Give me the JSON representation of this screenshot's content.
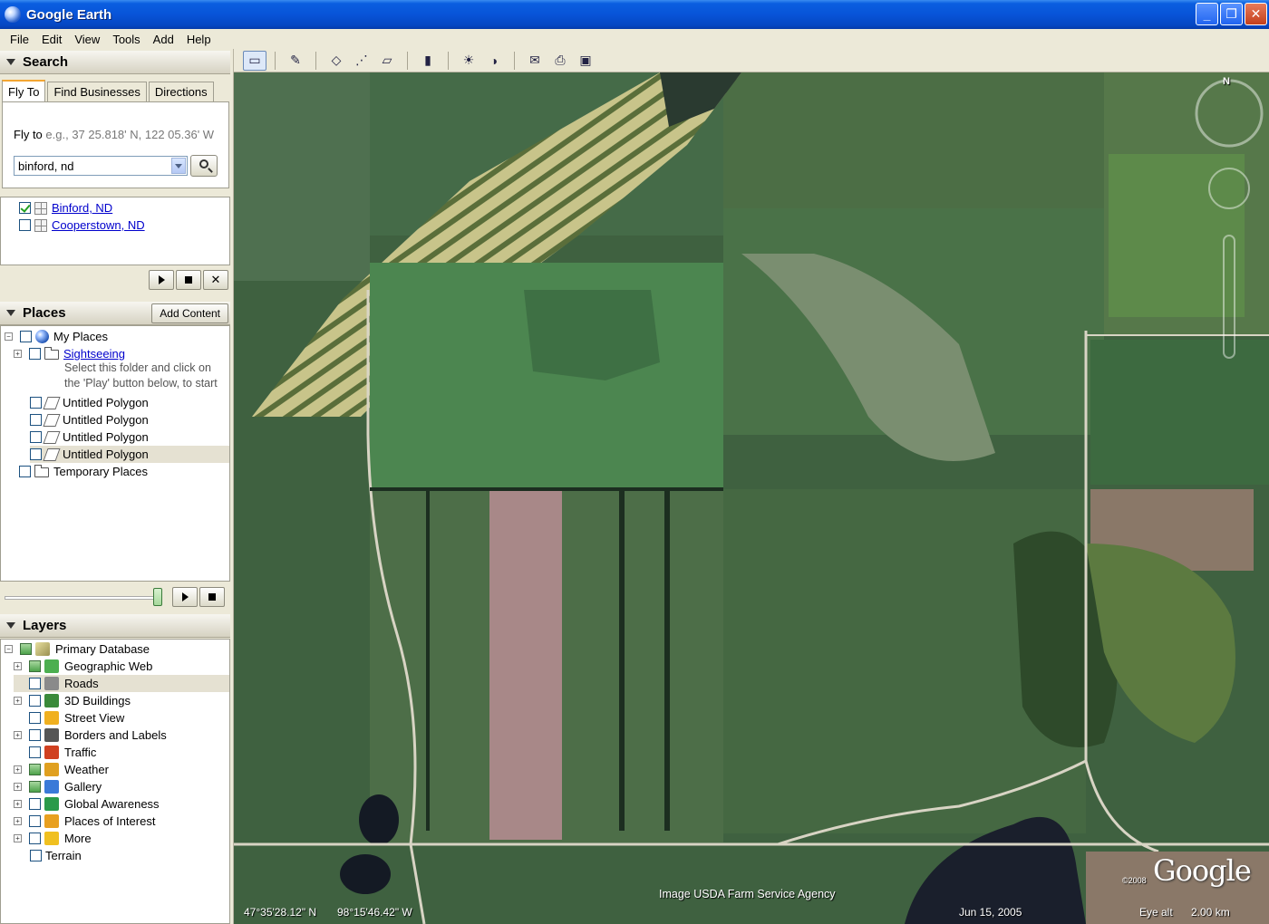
{
  "window": {
    "title": "Google Earth",
    "min": "_",
    "max": "❐",
    "close": "✕"
  },
  "menu": [
    "File",
    "Edit",
    "View",
    "Tools",
    "Add",
    "Help"
  ],
  "search": {
    "title": "Search",
    "tabs": [
      "Fly To",
      "Find Businesses",
      "Directions"
    ],
    "fly_label": "Fly to",
    "fly_hint": "e.g., 37 25.818' N, 122 05.36' W",
    "query": "binford, nd",
    "results": [
      "Binford, ND",
      "Cooperstown, ND"
    ]
  },
  "places": {
    "title": "Places",
    "add_content": "Add Content",
    "my_places": "My Places",
    "sightseeing": "Sightseeing",
    "hint_line1": "Select this folder and click on",
    "hint_line2": "the 'Play' button below, to start",
    "polygons": [
      "Untitled Polygon",
      "Untitled Polygon",
      "Untitled Polygon",
      "Untitled Polygon"
    ],
    "temporary": "Temporary Places"
  },
  "layers": {
    "title": "Layers",
    "root": "Primary Database",
    "items": [
      {
        "label": "Geographic Web",
        "icon": "star-icon",
        "color": "#4caf50",
        "expandable": true,
        "checked": "partial"
      },
      {
        "label": "Roads",
        "icon": "road-icon",
        "color": "#8a8a8a",
        "expandable": false,
        "checked": "none"
      },
      {
        "label": "3D Buildings",
        "icon": "building-icon",
        "color": "#3a8a3a",
        "expandable": true,
        "checked": "none"
      },
      {
        "label": "Street View",
        "icon": "person-icon",
        "color": "#f0b020",
        "expandable": false,
        "checked": "none"
      },
      {
        "label": "Borders and Labels",
        "icon": "flag-icon",
        "color": "#555555",
        "expandable": true,
        "checked": "none"
      },
      {
        "label": "Traffic",
        "icon": "traffic-light-icon",
        "color": "#d04020",
        "expandable": false,
        "checked": "none"
      },
      {
        "label": "Weather",
        "icon": "sun-icon",
        "color": "#e0a020",
        "expandable": true,
        "checked": "partial"
      },
      {
        "label": "Gallery",
        "icon": "gallery-star-icon",
        "color": "#3a7ad8",
        "expandable": true,
        "checked": "partial"
      },
      {
        "label": "Global Awareness",
        "icon": "globe-icon",
        "color": "#2a9a4a",
        "expandable": true,
        "checked": "none"
      },
      {
        "label": "Places of Interest",
        "icon": "pin-flag-icon",
        "color": "#e8a020",
        "expandable": true,
        "checked": "none"
      },
      {
        "label": "More",
        "icon": "more-icon",
        "color": "#f0c020",
        "expandable": true,
        "checked": "none"
      }
    ],
    "terrain": "Terrain"
  },
  "map": {
    "credit": "Image USDA Farm Service Agency",
    "lat": "47°35'28.12\" N",
    "lon": "98°15'46.42\" W",
    "date": "Jun 15, 2005",
    "eye_alt_label": "Eye alt",
    "eye_alt": "2.00 km",
    "copyright": "©2008",
    "logo": "Google",
    "compass_n": "N"
  }
}
